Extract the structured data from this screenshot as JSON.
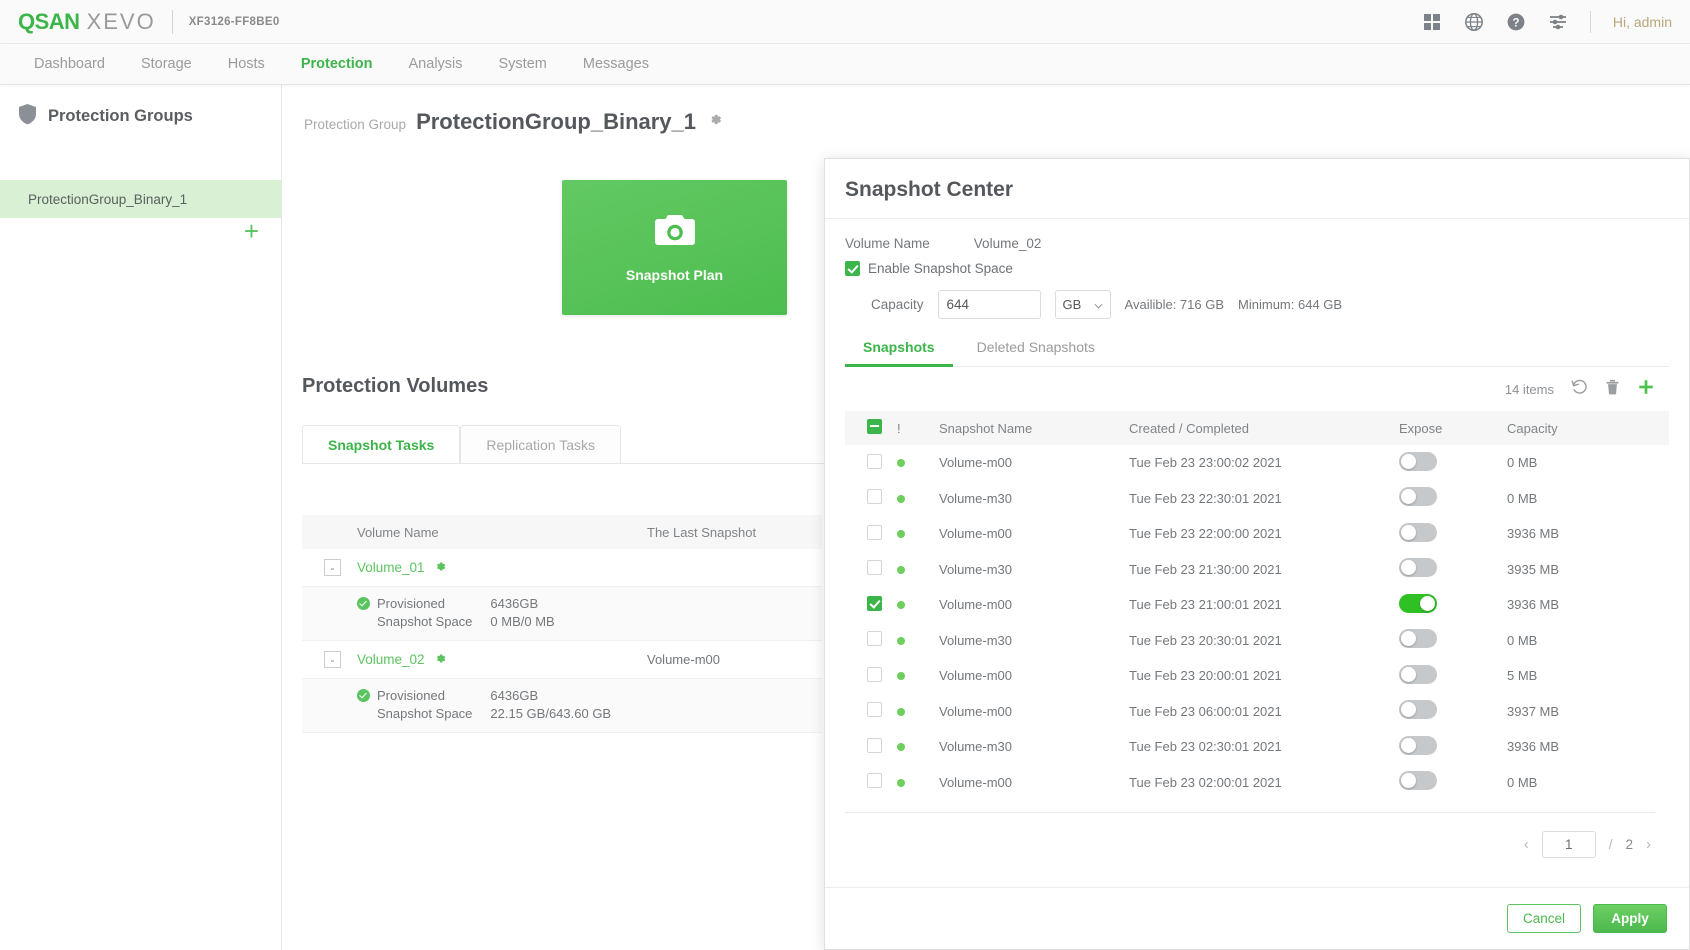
{
  "topbar": {
    "brand_qsan": "QSAN",
    "brand_xevo": "XEVO",
    "model": "XF3126-FF8BE0",
    "greeting": "Hi, admin",
    "icons": [
      "grid-icon",
      "globe-icon",
      "help-icon",
      "settings-sliders-icon"
    ],
    "brand_color": "#3cb54a"
  },
  "nav": {
    "items": [
      {
        "label": "Dashboard",
        "active": false
      },
      {
        "label": "Storage",
        "active": false
      },
      {
        "label": "Hosts",
        "active": false
      },
      {
        "label": "Protection",
        "active": true
      },
      {
        "label": "Analysis",
        "active": false
      },
      {
        "label": "System",
        "active": false
      },
      {
        "label": "Messages",
        "active": false
      }
    ]
  },
  "sidebar": {
    "title": "Protection Groups",
    "add_label": "+",
    "items": [
      {
        "label": "ProtectionGroup_Binary_1",
        "selected": true
      }
    ]
  },
  "page": {
    "breadcrumb_prefix": "Protection Group",
    "title": "ProtectionGroup_Binary_1",
    "plan_card": {
      "label": "Snapshot Plan",
      "icon": "camera-icon",
      "color": "#4cbd4f"
    }
  },
  "protection_volumes": {
    "title": "Protection Volumes",
    "tabs": [
      {
        "label": "Snapshot Tasks",
        "active": true
      },
      {
        "label": "Replication Tasks",
        "active": false
      }
    ],
    "columns": [
      "Volume Name",
      "The Last Snapshot"
    ],
    "rows": [
      {
        "expander": "-",
        "name": "Volume_01",
        "last_snapshot": "",
        "detail": {
          "status": "ok",
          "label1": "Provisioned",
          "value1": "6436GB",
          "label2": "Snapshot Space",
          "value2": "0 MB/0 MB"
        }
      },
      {
        "expander": "-",
        "name": "Volume_02",
        "last_snapshot": "Volume-m00",
        "detail": {
          "status": "ok",
          "label1": "Provisioned",
          "value1": "6436GB",
          "label2": "Snapshot Space",
          "value2": "22.15 GB/643.60 GB"
        }
      }
    ]
  },
  "dialog": {
    "title": "Snapshot Center",
    "volume_name_label": "Volume Name",
    "volume_name_value": "Volume_02",
    "enable_snapshot_space_label": "Enable Snapshot Space",
    "enable_snapshot_space_checked": true,
    "capacity_label": "Capacity",
    "capacity_value": "644",
    "capacity_unit": "GB",
    "available_text": "Availible: 716 GB",
    "minimum_text": "Minimum: 644 GB",
    "tabs": [
      {
        "label": "Snapshots",
        "active": true
      },
      {
        "label": "Deleted Snapshots",
        "active": false
      }
    ],
    "items_count": "14 items",
    "toolbar_icons": [
      "rollback-icon",
      "delete-icon",
      "add-icon"
    ],
    "table": {
      "columns": [
        "",
        "!",
        "Snapshot Name",
        "Created / Completed",
        "Expose",
        "Capacity"
      ],
      "header_checkbox_state": "indeterminate",
      "rows": [
        {
          "checked": false,
          "status": "ok",
          "name": "Volume-m00",
          "created": "Tue Feb 23 23:00:02 2021",
          "expose": false,
          "capacity": "0 MB"
        },
        {
          "checked": false,
          "status": "ok",
          "name": "Volume-m30",
          "created": "Tue Feb 23 22:30:01 2021",
          "expose": false,
          "capacity": "0 MB"
        },
        {
          "checked": false,
          "status": "ok",
          "name": "Volume-m00",
          "created": "Tue Feb 23 22:00:00 2021",
          "expose": false,
          "capacity": "3936 MB"
        },
        {
          "checked": false,
          "status": "ok",
          "name": "Volume-m30",
          "created": "Tue Feb 23 21:30:00 2021",
          "expose": false,
          "capacity": "3935 MB"
        },
        {
          "checked": true,
          "status": "ok",
          "name": "Volume-m00",
          "created": "Tue Feb 23 21:00:01 2021",
          "expose": true,
          "capacity": "3936 MB"
        },
        {
          "checked": false,
          "status": "ok",
          "name": "Volume-m30",
          "created": "Tue Feb 23 20:30:01 2021",
          "expose": false,
          "capacity": "0 MB"
        },
        {
          "checked": false,
          "status": "ok",
          "name": "Volume-m00",
          "created": "Tue Feb 23 20:00:01 2021",
          "expose": false,
          "capacity": "5 MB"
        },
        {
          "checked": false,
          "status": "ok",
          "name": "Volume-m00",
          "created": "Tue Feb 23 06:00:01 2021",
          "expose": false,
          "capacity": "3937 MB"
        },
        {
          "checked": false,
          "status": "ok",
          "name": "Volume-m30",
          "created": "Tue Feb 23 02:30:01 2021",
          "expose": false,
          "capacity": "3936 MB"
        },
        {
          "checked": false,
          "status": "ok",
          "name": "Volume-m00",
          "created": "Tue Feb 23 02:00:01 2021",
          "expose": false,
          "capacity": "0 MB"
        }
      ]
    },
    "pager": {
      "prev": "‹",
      "current": "1",
      "separator": "/",
      "total": "2",
      "next": "›"
    },
    "buttons": {
      "cancel": "Cancel",
      "apply": "Apply"
    }
  }
}
